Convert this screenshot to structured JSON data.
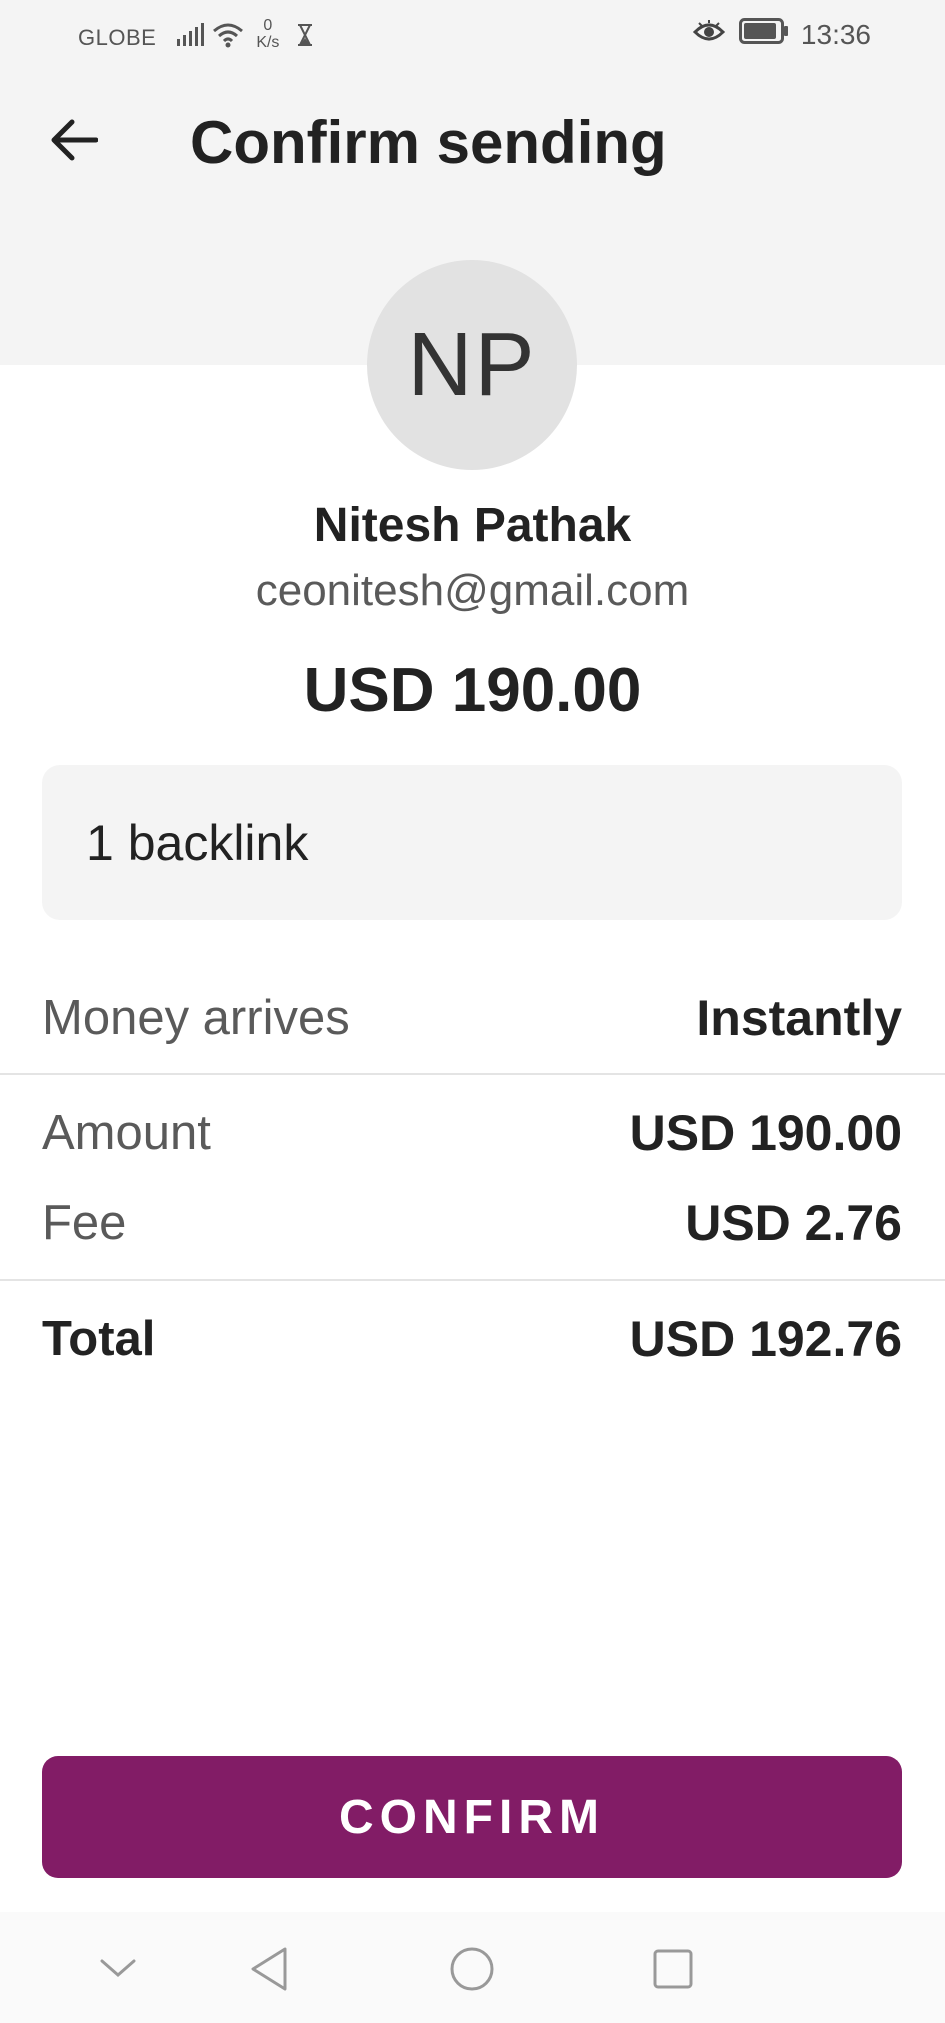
{
  "status_bar": {
    "carrier": "GLOBE",
    "speed_value": "0",
    "speed_unit": "K/s",
    "time": "13:36",
    "icons": [
      "signal-icon",
      "wifi-icon",
      "hourglass-icon",
      "eye-icon",
      "battery-icon"
    ]
  },
  "header": {
    "title": "Confirm sending",
    "back_icon": "arrow-left-icon"
  },
  "recipient": {
    "initials": "NP",
    "name": "Nitesh Pathak",
    "email": "ceonitesh@gmail.com"
  },
  "send_amount": "USD 190.00",
  "note": "1 backlink",
  "details": {
    "arrives_label": "Money arrives",
    "arrives_value": "Instantly",
    "amount_label": "Amount",
    "amount_value": "USD 190.00",
    "fee_label": "Fee",
    "fee_value": "USD 2.76",
    "total_label": "Total",
    "total_value": "USD 192.76"
  },
  "confirm_label": "CONFIRM",
  "colors": {
    "accent": "#821c66",
    "header_bg": "#f4f4f4",
    "avatar_bg": "#e2e2e2"
  },
  "nav": {
    "icons": [
      "chevron-down-icon",
      "back-triangle-icon",
      "home-circle-icon",
      "recents-square-icon"
    ]
  }
}
